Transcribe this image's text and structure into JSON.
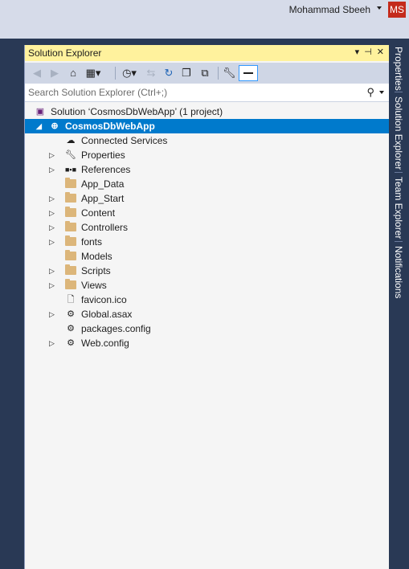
{
  "user": {
    "name": "Mohammad Sbeeh",
    "initials": "MS",
    "avatar_color": "#c42b1c"
  },
  "panel": {
    "title": "Solution Explorer",
    "header_icons": [
      "dropdown-arrow-icon",
      "pin-icon",
      "close-icon"
    ],
    "toolbar_icons": [
      "back-icon",
      "forward-icon",
      "home-icon",
      "switch-views-icon",
      "pending-changes-filter-icon",
      "sync-icon",
      "refresh-icon",
      "collapse-all-icon",
      "show-all-files-icon",
      "properties-icon",
      "preview-icon"
    ],
    "search_placeholder": "Search Solution Explorer (Ctrl+;)"
  },
  "tree": {
    "solution": "Solution ‘CosmosDbWebApp’ (1 project)",
    "project": "CosmosDbWebApp",
    "items": [
      {
        "label": "Connected Services",
        "icon": "cloud-services-icon",
        "expandable": false
      },
      {
        "label": "Properties",
        "icon": "wrench-icon",
        "expandable": true
      },
      {
        "label": "References",
        "icon": "references-icon",
        "expandable": true
      },
      {
        "label": "App_Data",
        "icon": "folder-icon",
        "expandable": false
      },
      {
        "label": "App_Start",
        "icon": "folder-icon",
        "expandable": true
      },
      {
        "label": "Content",
        "icon": "folder-icon",
        "expandable": true
      },
      {
        "label": "Controllers",
        "icon": "folder-icon",
        "expandable": true
      },
      {
        "label": "fonts",
        "icon": "folder-icon",
        "expandable": true
      },
      {
        "label": "Models",
        "icon": "folder-icon",
        "expandable": false
      },
      {
        "label": "Scripts",
        "icon": "folder-icon",
        "expandable": true
      },
      {
        "label": "Views",
        "icon": "folder-icon",
        "expandable": true
      },
      {
        "label": "favicon.ico",
        "icon": "icon-file-icon",
        "expandable": false
      },
      {
        "label": "Global.asax",
        "icon": "asax-file-icon",
        "expandable": true
      },
      {
        "label": "packages.config",
        "icon": "config-file-icon",
        "expandable": false
      },
      {
        "label": "Web.config",
        "icon": "config-file-icon",
        "expandable": true
      }
    ]
  },
  "side_tabs": [
    "Properties",
    "Solution Explorer",
    "Team Explorer",
    "Notifications"
  ],
  "colors": {
    "header_active": "#fff29d",
    "selection": "#007acc",
    "frame": "#293955",
    "folder": "#dcb67a"
  }
}
